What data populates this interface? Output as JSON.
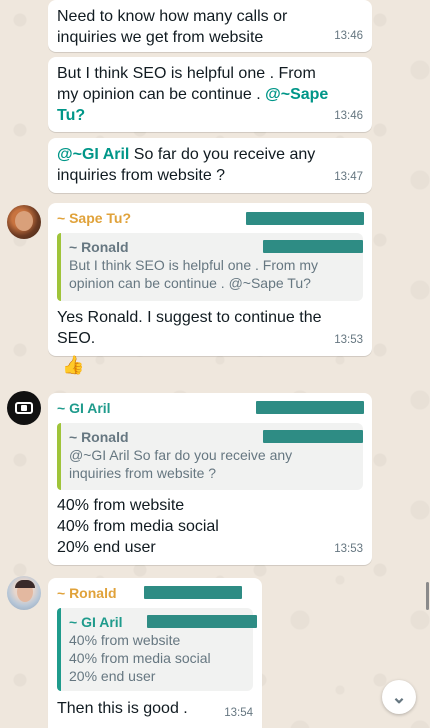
{
  "messages": [
    {
      "text": "Need to know how many calls or\ninquiries we get from website",
      "time": "13:46"
    },
    {
      "text_before": "But I think SEO is helpful one . From\nmy opinion can be continue . ",
      "mention": "@~Sape\nTu?",
      "time": "13:46"
    },
    {
      "mention": "@~GI Aril",
      "text_after": "  So far do you receive any\ninquiries from website ?",
      "time": "13:47"
    },
    {
      "sender": "~ Sape Tu?",
      "quote_sender": "~ Ronald",
      "quote_text": "But I think SEO is helpful one . From my\nopinion can be continue . @~Sape Tu?",
      "text": "Yes Ronald. I suggest to continue the\nSEO.",
      "time": "13:53",
      "reaction": "👍"
    },
    {
      "sender": "~ GI Aril",
      "quote_sender": "~ Ronald",
      "quote_text": "@~GI Aril  So far do you receive any\ninquiries from website ?",
      "text": "40% from website\n40% from media social\n20% end user",
      "time": "13:53"
    },
    {
      "sender": "~ Ronald",
      "quote_sender": "~ GI Aril",
      "quote_text": "40% from website\n40% from media social\n20% end user",
      "text": "Then this is good .",
      "time": "13:54"
    }
  ],
  "icons": {
    "scroll_down": "double-chevron-down-icon",
    "reaction": "thumbs-up-icon"
  },
  "colors": {
    "background": "#efe7dd",
    "bubble": "#ffffff",
    "mention": "#009688",
    "sender_teal": "#1f9b8c",
    "sender_orange": "#e0a23a",
    "quote_bar_green": "#9fc43a",
    "redaction": "#2e8c84"
  }
}
